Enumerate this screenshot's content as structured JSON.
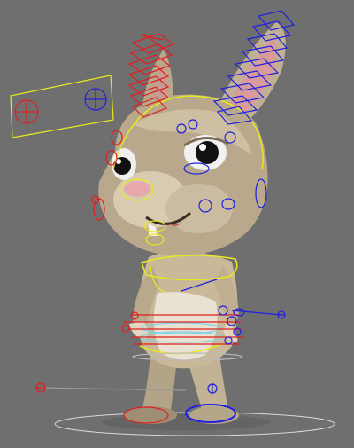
{
  "viewport": {
    "background": "#6f6f6f"
  },
  "subject": {
    "fur_light": "#d7c9ad",
    "fur_mid": "#b8a78a",
    "fur_dark": "#8f806a",
    "ear_inner": "#d99c9c",
    "nose": "#e7a9ad",
    "eye_white": "#f2f2f2",
    "pupil": "#111111"
  },
  "rig_colors": {
    "left_side": "#e02020",
    "right_side": "#2020e0",
    "center": "#e8e820",
    "aux": "#7fd0e8",
    "ground": "#d8d8d8"
  }
}
